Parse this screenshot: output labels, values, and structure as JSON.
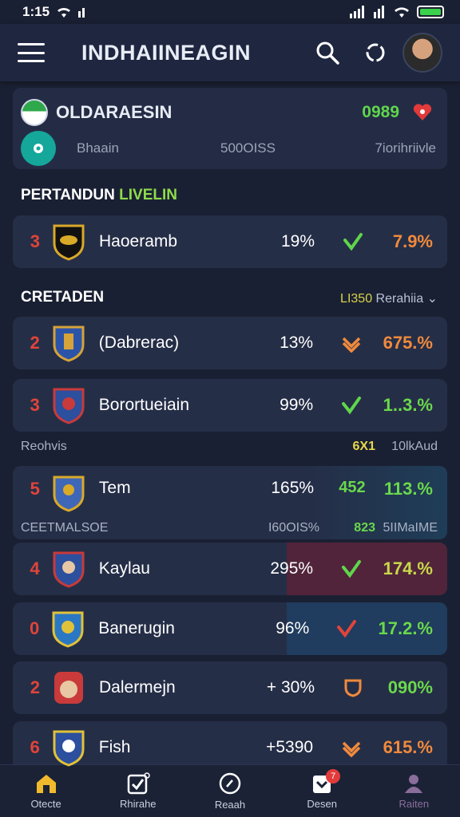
{
  "status_bar": {
    "time": "1:15"
  },
  "header": {
    "title": "INDHAIINEAGIN"
  },
  "league": {
    "name": "OLDARAESIN",
    "score": "0989",
    "col1": "Bhaain",
    "col2": "500OISS",
    "col3": "7iorihriivle"
  },
  "section1": {
    "title": "PERTANDUN",
    "title_accent": "LIVELIN"
  },
  "section2": {
    "title": "CRETADEN",
    "right_highlight": "LI350",
    "right_text": "Rerahiia",
    "right_chevron": "⌄"
  },
  "subrow1": {
    "c1": "Reohvis",
    "c3": "6X1",
    "c4": "10lkAud"
  },
  "subrow2": {
    "c1": "CEETMALSOE",
    "c2": "I60OIS%",
    "c3": "823",
    "c4": "5IIMaIME"
  },
  "rows": [
    {
      "rank": "3",
      "team": "Haoeramb",
      "pct": "19%",
      "status_icon": "check-shield-icon",
      "change": "7.9%",
      "change_color": "#f08a3c",
      "crest_colors": [
        "#111111",
        "#d9a928"
      ]
    },
    {
      "rank": "2",
      "team": "(Dabrerac)",
      "pct": "13%",
      "status_icon": "double-chevron-icon",
      "change": "675.%",
      "change_color": "#f08a3c",
      "crest_colors": [
        "#d6a23a",
        "#2b54a8"
      ]
    },
    {
      "rank": "3",
      "team": "Borortueiain",
      "pct": "99%",
      "status_icon": "check-shield-icon",
      "change": "1..3.%",
      "change_color": "#6ad84c",
      "crest_colors": [
        "#c93a3a",
        "#2c4f9e"
      ]
    },
    {
      "rank": "5",
      "team": "Tem",
      "pct": "165%",
      "status_text": "452",
      "change": "113.%",
      "change_color": "#6ad84c",
      "crest_colors": [
        "#3f67b8",
        "#d9a928"
      ]
    },
    {
      "rank": "4",
      "team": "Kaylau",
      "pct": "295%",
      "status_icon": "check-shield-icon",
      "change": "174.%",
      "change_color": "#c8d84a",
      "crest_colors": [
        "#c93a3a",
        "#2c4f9e"
      ]
    },
    {
      "rank": "0",
      "team": "Banerugin",
      "pct": "96%",
      "status_icon": "check-shield-icon",
      "change": "17.2.%",
      "change_color": "#6ad84c",
      "crest_colors": [
        "#2a78c4",
        "#e0c23a"
      ]
    },
    {
      "rank": "2",
      "team": "Dalermejn",
      "pct": "+ 30%",
      "status_icon": "shield-icon",
      "change": "090%",
      "change_color": "#6ad84c",
      "crest_colors": [
        "#c93a3a",
        "#e7c7a4"
      ]
    },
    {
      "rank": "6",
      "team": "Fish",
      "pct": "+5390",
      "status_icon": "double-chevron-icon",
      "change": "615.%",
      "change_color": "#f08a3c",
      "crest_colors": [
        "#2c4f9e",
        "#e0c23a"
      ]
    }
  ],
  "nav": [
    {
      "label": "Otecte",
      "icon": "home-icon"
    },
    {
      "label": "Rhirahe",
      "icon": "calendar-check-icon"
    },
    {
      "label": "Reaah",
      "icon": "compass-icon"
    },
    {
      "label": "Desen",
      "icon": "trophy-icon",
      "badge": "7"
    },
    {
      "label": "Raiten",
      "icon": "person-icon"
    }
  ]
}
